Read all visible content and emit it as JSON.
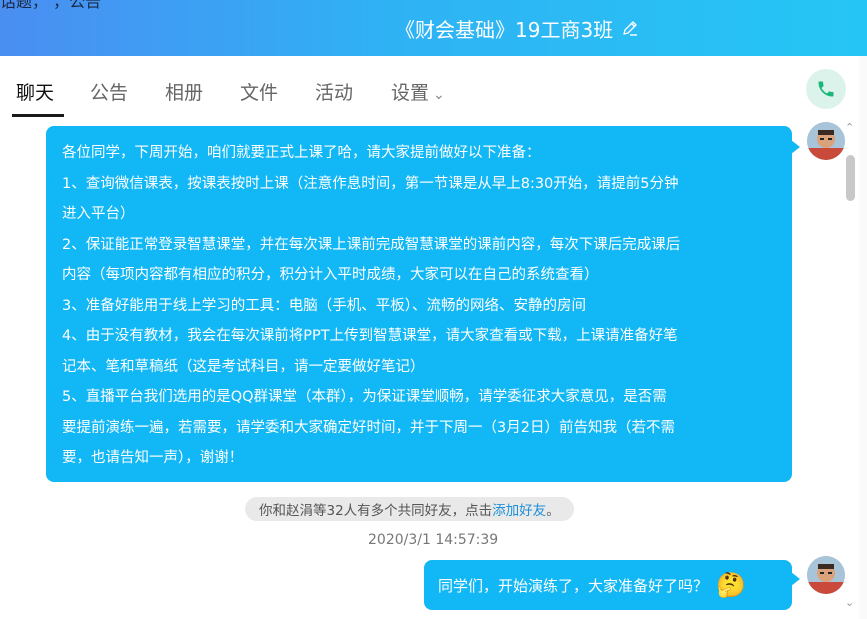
{
  "header": {
    "clipped_text": "话题，   ，公告",
    "title": "《财会基础》19工商3班",
    "edit_icon": "pencil-icon"
  },
  "nav": {
    "tabs": [
      "聊天",
      "公告",
      "相册",
      "文件",
      "活动",
      "设置"
    ],
    "active_tab": "聊天",
    "settings_icon": "chevron-down-icon",
    "phone_icon": "phone-icon"
  },
  "messages": [
    {
      "sender": "self",
      "lines": [
        "各位同学，下周开始，咱们就要正式上课了哈，请大家提前做好以下准备：",
        "1、查询微信课表，按课表按时上课（注意作息时间，第一节课是从早上8:30开始，请提前5分钟",
        "进入平台）",
        "2、保证能正常登录智慧课堂，并在每次课上课前完成智慧课堂的课前内容，每次下课后完成课后",
        "内容（每项内容都有相应的积分，积分计入平时成绩，大家可以在自己的系统查看）",
        "3、准备好能用于线上学习的工具：电脑（手机、平板）、流畅的网络、安静的房间",
        "4、由于没有教材，我会在每次课前将PPT上传到智慧课堂，请大家查看或下载，上课请准备好笔",
        "记本、笔和草稿纸（这是考试科目，请一定要做好笔记）",
        "5、直播平台我们选用的是QQ群课堂（本群），为保证课堂顺畅，请学委征求大家意见，是否需",
        "要提前演练一遍，若需要，请学委和大家确定好时间，并于下周一（3月2日）前告知我（若不需",
        "要，也请告知一声），谢谢！"
      ]
    },
    {
      "sender": "self",
      "text": "同学们，开始演练了，大家准备好了吗？",
      "emoji": "🤔"
    }
  ],
  "notice": {
    "text": "你和赵涓等32人有多个共同好友，点击",
    "link": "添加好友",
    "suffix": "。"
  },
  "timestamp": "2020/3/1 14:57:39",
  "colors": {
    "bubble": "#12b7f5",
    "header_start": "#4a8ef2",
    "header_end": "#25c6f5",
    "link": "#1e90d8"
  }
}
